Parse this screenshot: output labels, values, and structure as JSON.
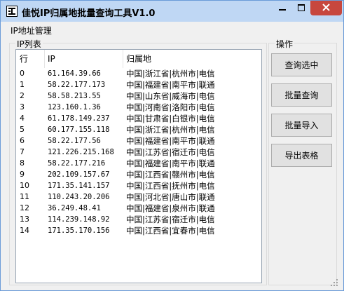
{
  "window": {
    "title": "佳悦IP归属地批量查询工具V1.0",
    "min_symbol": "—",
    "max_symbol": "□",
    "close_symbol": "✕"
  },
  "menu": {
    "label": "IP地址管理"
  },
  "list_group": {
    "title": "IP列表",
    "columns": [
      "行",
      "IP",
      "归属地"
    ],
    "rows": [
      {
        "row": "0",
        "ip": "61.164.39.66",
        "location": "中国|浙江省|杭州市|电信"
      },
      {
        "row": "1",
        "ip": "58.22.177.173",
        "location": "中国|福建省|南平市|联通"
      },
      {
        "row": "2",
        "ip": "58.58.213.55",
        "location": "中国|山东省|威海市|电信"
      },
      {
        "row": "3",
        "ip": "123.160.1.36",
        "location": "中国|河南省|洛阳市|电信"
      },
      {
        "row": "4",
        "ip": "61.178.149.237",
        "location": "中国|甘肃省|白银市|电信"
      },
      {
        "row": "5",
        "ip": "60.177.155.118",
        "location": "中国|浙江省|杭州市|电信"
      },
      {
        "row": "6",
        "ip": "58.22.177.56",
        "location": "中国|福建省|南平市|联通"
      },
      {
        "row": "7",
        "ip": "121.226.215.168",
        "location": "中国|江苏省|宿迁市|电信"
      },
      {
        "row": "8",
        "ip": "58.22.177.216",
        "location": "中国|福建省|南平市|联通"
      },
      {
        "row": "9",
        "ip": "202.109.157.67",
        "location": "中国|江西省|赣州市|电信"
      },
      {
        "row": "10",
        "ip": "171.35.141.157",
        "location": "中国|江西省|抚州市|电信"
      },
      {
        "row": "11",
        "ip": "110.243.20.206",
        "location": "中国|河北省|唐山市|联通"
      },
      {
        "row": "12",
        "ip": "36.249.48.41",
        "location": "中国|福建省|泉州市|联通"
      },
      {
        "row": "13",
        "ip": "114.239.148.92",
        "location": "中国|江苏省|宿迁市|电信"
      },
      {
        "row": "14",
        "ip": "171.35.170.156",
        "location": "中国|江西省|宜春市|电信"
      }
    ]
  },
  "ops_group": {
    "title": "操作",
    "buttons": [
      "查询选中",
      "批量查询",
      "批量导入",
      "导出表格"
    ]
  },
  "colors": {
    "titlebar": "#bfd7f4",
    "close_button": "#c7473e",
    "window_bg": "#f0f0f0",
    "list_bg": "#ffffff"
  }
}
